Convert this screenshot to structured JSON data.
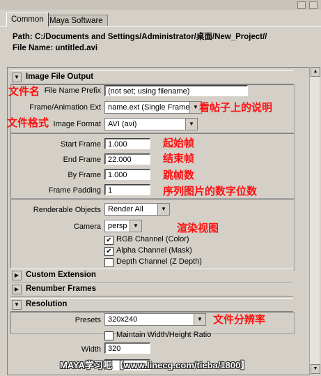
{
  "tabs": [
    {
      "label": "Common",
      "active": true
    },
    {
      "label": "Maya Software",
      "active": false
    }
  ],
  "path_info": {
    "path": "Path: C:/Documents and Settings/Administrator/桌面/New_Project//",
    "file_name": "File Name:  untitled.avi"
  },
  "image_file_output": {
    "title": "Image File Output",
    "file_name_prefix": {
      "label": "File Name Prefix",
      "value": "(not set; using filename)"
    },
    "frame_animation_ext": {
      "label": "Frame/Animation Ext",
      "value": "name.ext (Single Frame)"
    },
    "image_format": {
      "label": "Image Format",
      "value": "AVI (avi)"
    },
    "start_frame": {
      "label": "Start Frame",
      "value": "1.000"
    },
    "end_frame": {
      "label": "End Frame",
      "value": "22.000"
    },
    "by_frame": {
      "label": "By Frame",
      "value": "1.000"
    },
    "frame_padding": {
      "label": "Frame Padding",
      "value": "1"
    },
    "renderable_objects": {
      "label": "Renderable Objects",
      "value": "Render All"
    },
    "camera": {
      "label": "Camera",
      "value": "persp"
    },
    "rgb_channel": {
      "label": "RGB Channel (Color)",
      "checked": true
    },
    "alpha_channel": {
      "label": "Alpha Channel (Mask)",
      "checked": true
    },
    "depth_channel": {
      "label": "Depth Channel (Z Depth)",
      "checked": false
    }
  },
  "custom_extension": {
    "title": "Custom Extension"
  },
  "renumber_frames": {
    "title": "Renumber Frames"
  },
  "resolution": {
    "title": "Resolution",
    "presets": {
      "label": "Presets",
      "value": "320x240"
    },
    "maintain_ratio": {
      "label": "Maintain Width/Height Ratio",
      "checked": false
    },
    "width": {
      "label": "Width",
      "value": "320"
    }
  },
  "annotations": {
    "file_name": "文件名",
    "see_post": "看帖子上的说明",
    "file_format": "文件格式",
    "start_frame": "起始帧",
    "end_frame": "结束帧",
    "by_frame": "跳帧数",
    "padding": "序列图片的数字位数",
    "render_view": "渲染视图",
    "resolution": "文件分辨率"
  },
  "watermark": "MAYA学习吧 【www.linecg.com/tieba/1800】",
  "glyphs": {
    "expanded": "▼",
    "collapsed": "▶",
    "combo": "▼",
    "check": "✔",
    "up": "▲",
    "down": "▼"
  }
}
